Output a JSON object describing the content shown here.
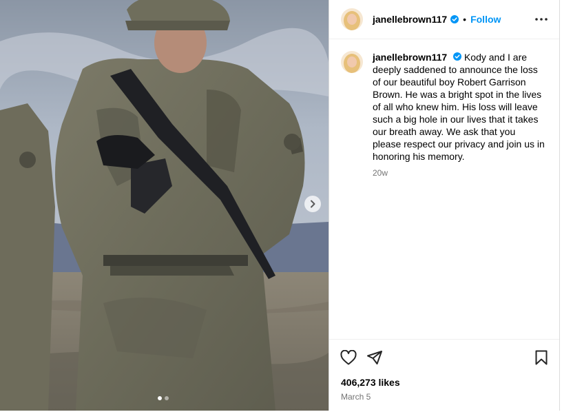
{
  "post": {
    "username": "janellebrown117",
    "separator": "•",
    "follow_label": "Follow",
    "caption_username": "janellebrown117",
    "caption_text": "Kody and I are deeply saddened to announce the loss of our beautiful boy Robert Garrison Brown. He was a bright spot in the lives of all who knew him. His loss will leave such a big hole in our lives that it takes our breath away. We ask that you please respect our privacy and join us in honoring his memory.",
    "caption_age": "20w",
    "likes": "406,273 likes",
    "date": "March 5"
  },
  "carousel": {
    "slide_count": 2,
    "active_index": 0
  },
  "colors": {
    "accent": "#0095f6",
    "verified": "#0095f6",
    "muted": "#737373"
  },
  "icons": [
    "verified-badge-icon",
    "more-options-icon",
    "heart-icon",
    "share-icon",
    "bookmark-icon",
    "chevron-right-icon"
  ]
}
